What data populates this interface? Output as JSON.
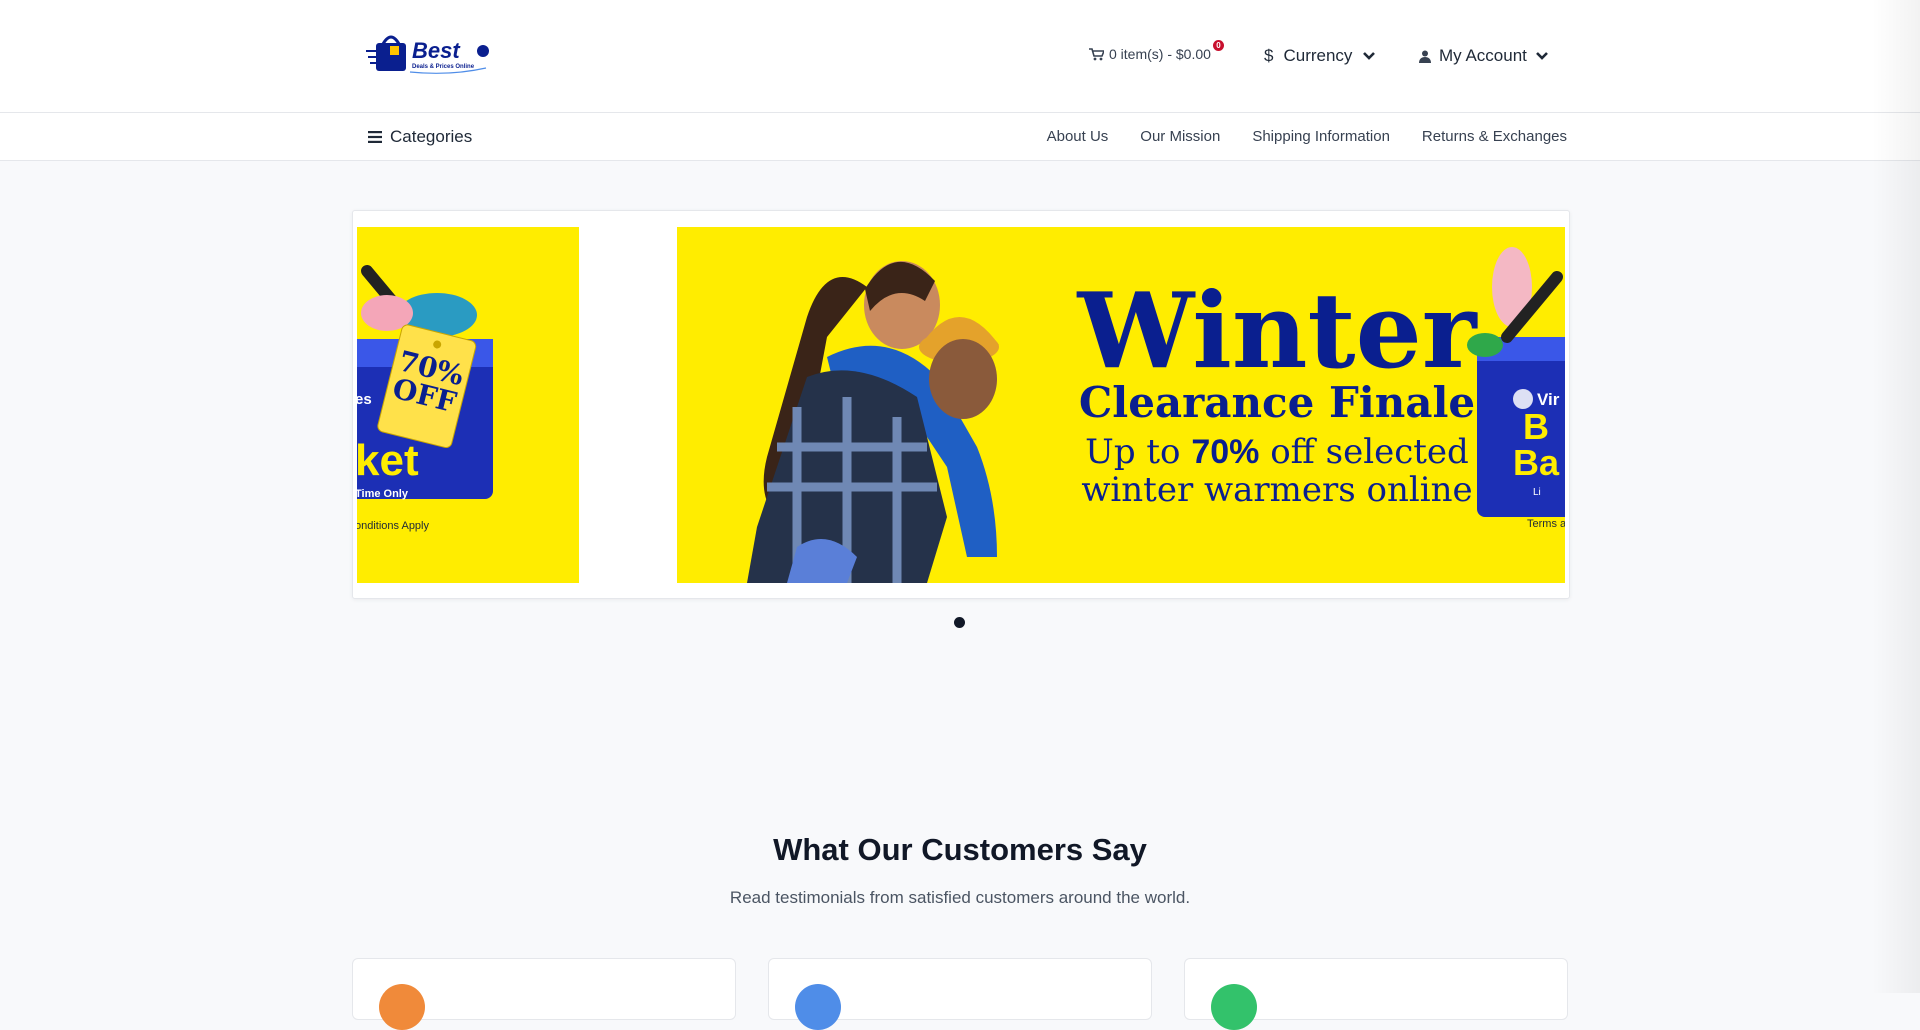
{
  "header": {
    "logo": {
      "brand": "Best",
      "tagline": "Deals & Prices Online"
    },
    "cart": {
      "label": "0 item(s) - $0.00",
      "badge_count": "0",
      "icon": "shopping-cart-icon"
    },
    "currency": {
      "symbol": "$",
      "label": "Currency"
    },
    "account": {
      "label": "My Account",
      "icon": "user-icon"
    }
  },
  "nav": {
    "categories_label": "Categories",
    "links": [
      "About Us",
      "Our Mission",
      "Shipping Information",
      "Returns & Exchanges"
    ]
  },
  "slider": {
    "left_banner": {
      "badge_line1": "70%",
      "badge_line2": "OFF",
      "partial_text": "es",
      "big_text": "ket",
      "time_text": "Time Only",
      "terms_text": "onditions Apply"
    },
    "main_banner": {
      "headline": "Winter",
      "subheadline": "Clearance Finale",
      "offer_prefix": "Up to ",
      "offer_bold": "70%",
      "offer_suffix": " off selected",
      "offer_line2": "winter warmers online"
    },
    "right_banner": {
      "partial1": "Vir",
      "partial2": "B",
      "partial3": "Ba",
      "partial4": "Li",
      "terms_partial": "Terms a"
    },
    "dots": 1,
    "active_dot": 1
  },
  "testimonials": {
    "title": "What Our Customers Say",
    "subtitle": "Read testimonials from satisfied customers around the world.",
    "cards": [
      {
        "avatar_color": "#f08a3a"
      },
      {
        "avatar_color": "#4f8de8"
      },
      {
        "avatar_color": "#33c26b"
      }
    ]
  },
  "colors": {
    "banner_yellow": "#ffed00",
    "banner_blue": "#0a1f8f",
    "badge_red": "#c8102e",
    "text_dark": "#111827"
  }
}
